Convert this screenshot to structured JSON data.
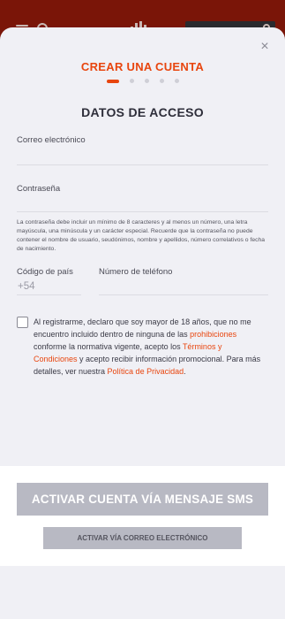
{
  "modal": {
    "title": "CREAR UNA CUENTA",
    "section_title": "DATOS DE ACCESO",
    "close_symbol": "×"
  },
  "form": {
    "email_label": "Correo electrónico",
    "password_label": "Contraseña",
    "password_help": "La contraseña debe incluir un mínimo de 8 caracteres y al menos un número, una letra mayúscula, una minúscula y un carácter especial. Recuerde que la contraseña no puede contener el nombre de usuario, seudónimos, nombre y apellidos, número correlativos o fecha de nacimiento.",
    "country_code_label": "Código de país",
    "country_code_value": "+54",
    "phone_label": "Número de teléfono"
  },
  "terms": {
    "part1": "Al registrarme, declaro que soy mayor de 18 años, que no me encuentro incluido dentro de ninguna de las ",
    "link_prohibiciones": "prohibiciones",
    "part2": " conforme la normativa vigente, acepto los ",
    "link_terminos": "Términos y Condiciones",
    "part3": " y acepto recibir información promocional. Para más detalles, ver nuestra ",
    "link_privacidad": "Política de Privacidad",
    "part4": "."
  },
  "actions": {
    "sms_button": "ACTIVAR CUENTA VÍA MENSAJE SMS",
    "email_button": "ACTIVAR VÍA CORREO ELECTRÓNICO"
  },
  "steps": {
    "total": 5,
    "active": 1
  },
  "colors": {
    "accent": "#e8450e",
    "button_disabled": "#b8b9c3",
    "header_dimmed": "#7a1508"
  }
}
